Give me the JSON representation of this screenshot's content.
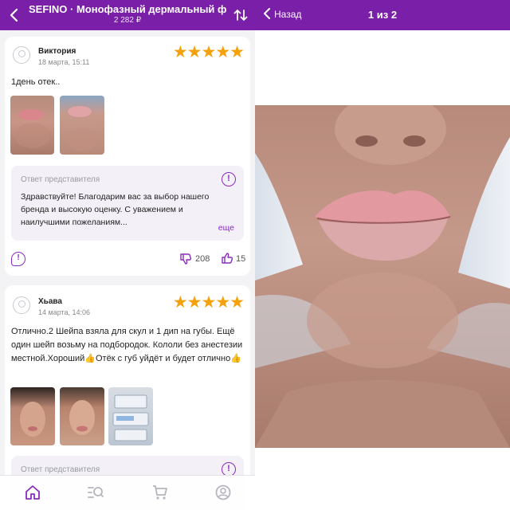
{
  "header": {
    "title": "SEFINO · Монофазный дермальный фи...",
    "price": "2 282 ₽"
  },
  "reviews": [
    {
      "name": "Виктория",
      "date": "18 марта, 15:11",
      "rating": 5,
      "stars": "★★★★★",
      "text": "1день отек..",
      "reply": {
        "title": "Ответ представителя",
        "text": "Здравствуйте! Благодарим вас за выбор нашего бренда и высокую оценку. С уважением и наилучшими пожеланиям...",
        "more": "еще"
      },
      "dislikes": "208",
      "likes": "15"
    },
    {
      "name": "Хьава",
      "date": "14 марта, 14:06",
      "rating": 5,
      "stars": "★★★★★",
      "text": "Отлично.2 Шейпа взяла для скул и 1 дип на губы. Ещё один шейп возьму на подбородок. Кололи без анестезии местной.Хороший👍Отёк с губ уйдёт и будет отлично👍",
      "reply": {
        "title": "Ответ представителя"
      }
    }
  ],
  "viewer": {
    "back_label": "Назад",
    "counter": "1 из 2"
  },
  "icons": {
    "reply": "!",
    "chat": "!"
  },
  "nav": [
    "home-icon",
    "catalog-icon",
    "cart-icon",
    "profile-icon"
  ],
  "colors": {
    "brand": "#7a1fa8",
    "accent": "#8a2cc0",
    "star": "#f5a10b"
  }
}
